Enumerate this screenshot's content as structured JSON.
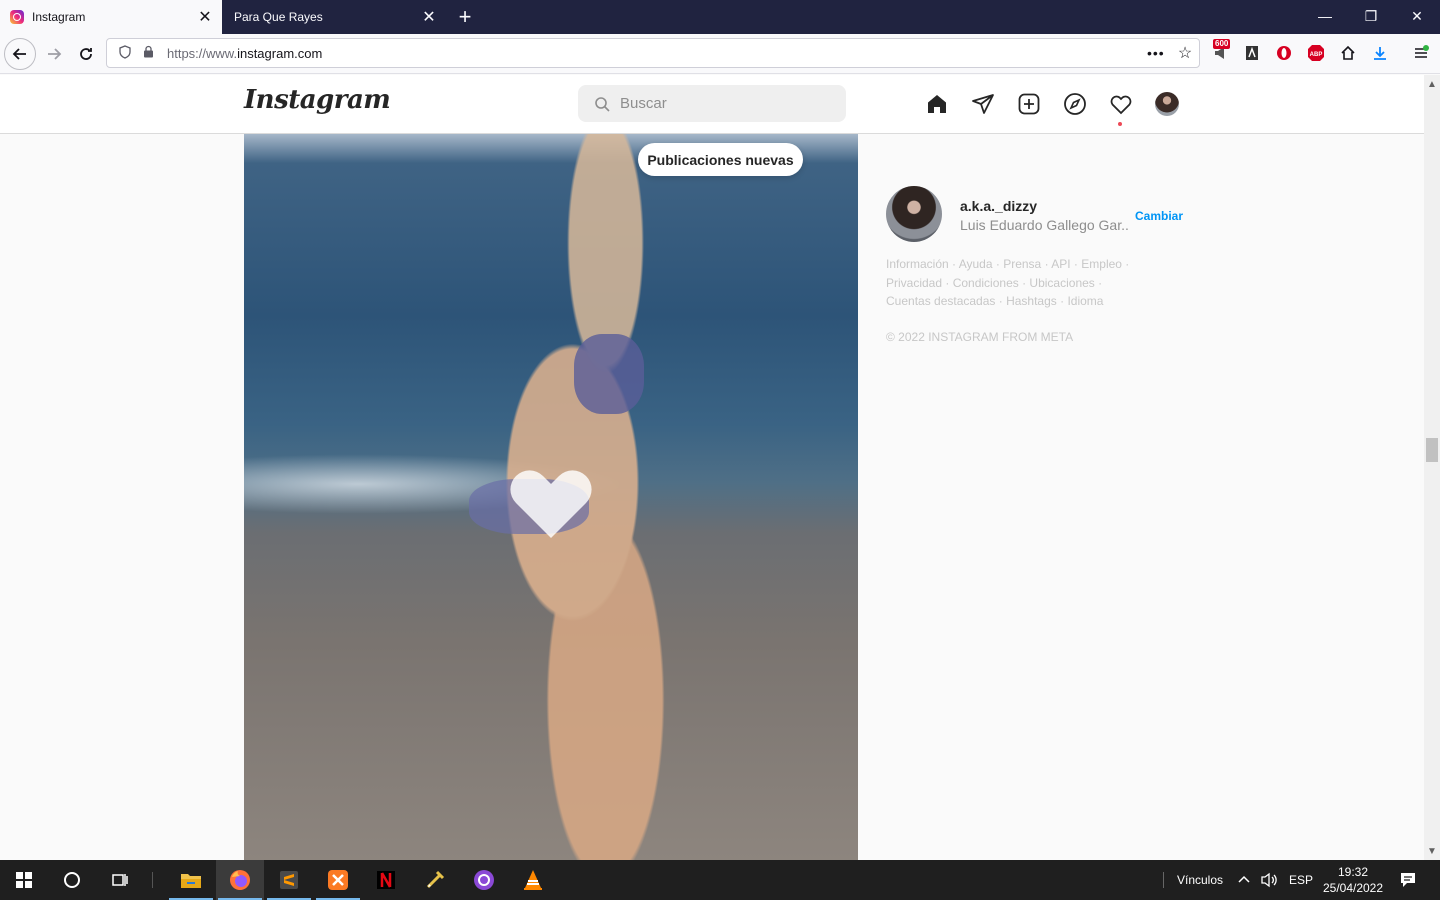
{
  "browser": {
    "tabs": [
      {
        "label": "Instagram",
        "active": true
      },
      {
        "label": "Para Que Rayes",
        "active": false
      }
    ],
    "new_tab_symbol": "+",
    "url_prefix": "https://www.",
    "url_host": "instagram.com",
    "url_more": "•••",
    "extension_badge": "600",
    "window_controls": {
      "minimize": "—",
      "restore": "❐",
      "close": "✕"
    }
  },
  "instagram": {
    "logo": "Instagram",
    "search_placeholder": "Buscar",
    "nav_icons": [
      "home-icon",
      "direct-icon",
      "new-post-icon",
      "explore-icon",
      "activity-icon",
      "profile-icon"
    ],
    "new_posts_pill": "Publicaciones nuevas",
    "sidebar": {
      "username": "a.k.a._dizzy",
      "full_name": "Luis Eduardo Gallego Gar...",
      "switch_label": "Cambiar"
    },
    "footer": {
      "links": [
        "Información",
        "Ayuda",
        "Prensa",
        "API",
        "Empleo",
        "Privacidad",
        "Condiciones",
        "Ubicaciones",
        "Cuentas destacadas",
        "Hashtags",
        "Idioma"
      ],
      "separator": " · ",
      "copyright": "© 2022 INSTAGRAM FROM META"
    },
    "colors": {
      "accent": "#0095f6",
      "notification_dot": "#ed4956"
    }
  },
  "taskbar": {
    "apps": [
      "windows-start-icon",
      "cortana-icon",
      "task-view-icon",
      "file-explorer-icon",
      "firefox-icon",
      "sublime-text-icon",
      "xampp-icon",
      "netflix-icon",
      "tool-icon",
      "github-desktop-icon",
      "vlc-icon"
    ],
    "links_label": "Vínculos",
    "language": "ESP",
    "time": "19:32",
    "date": "25/04/2022"
  }
}
